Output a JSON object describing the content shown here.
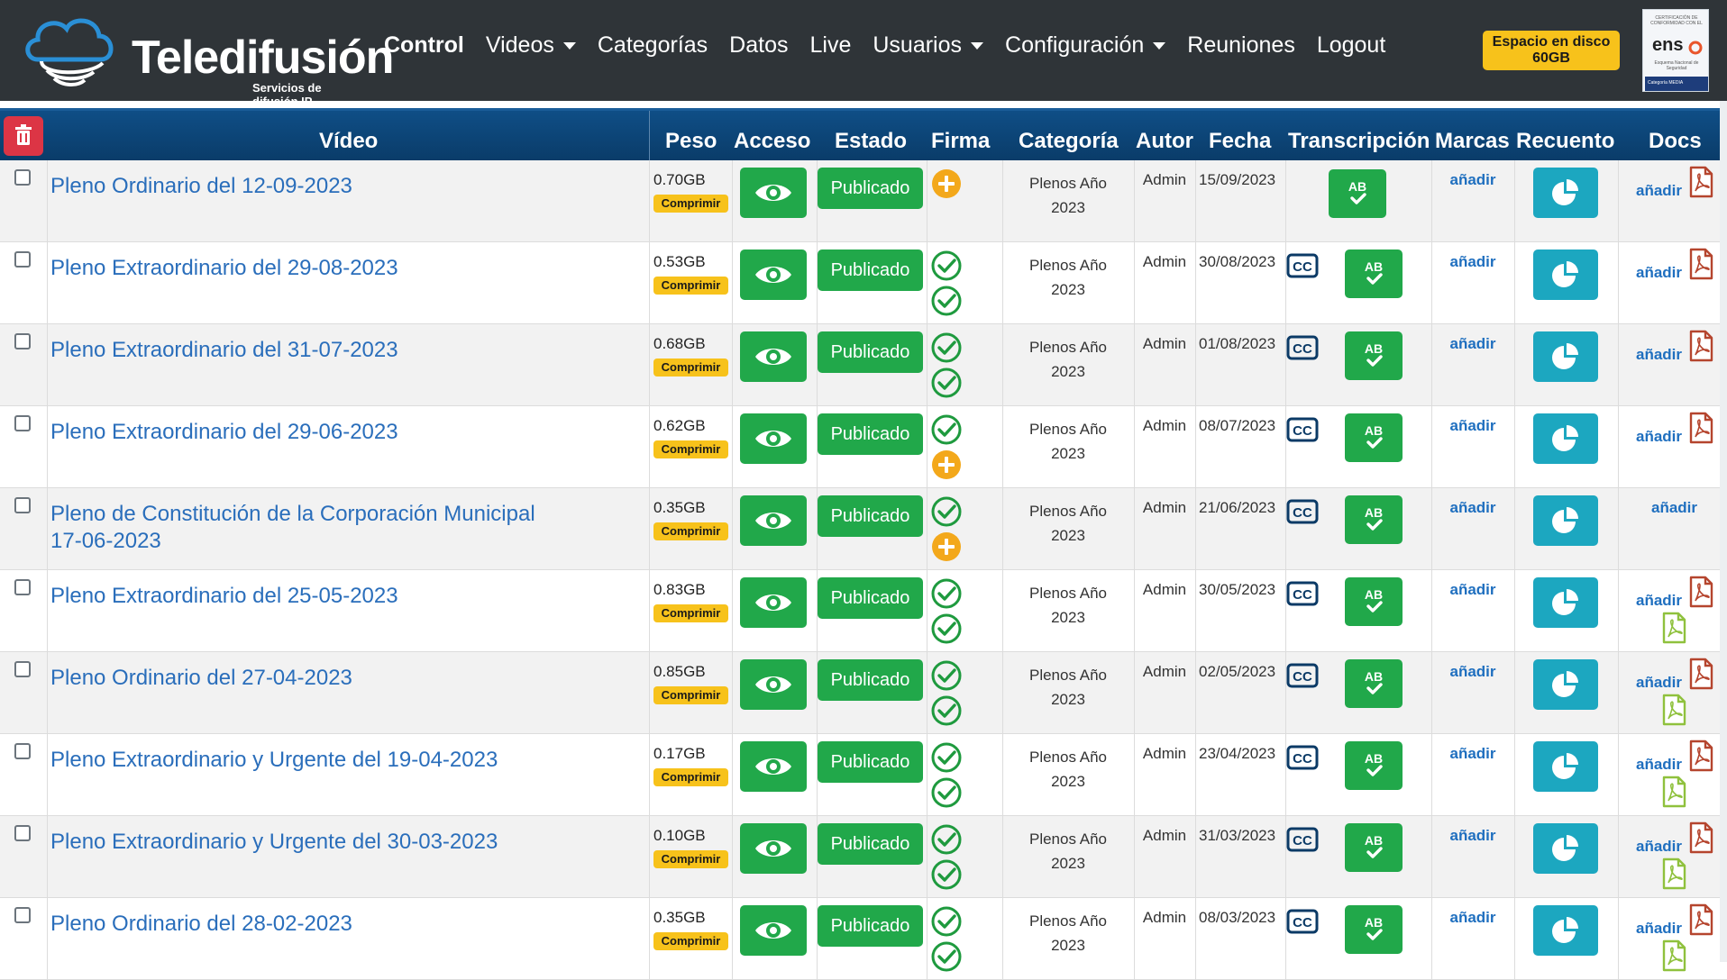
{
  "brand": {
    "name": "Teledifusión",
    "subtitle": "Servicios de difusión IP"
  },
  "nav": [
    {
      "label": "Control",
      "active": true,
      "dropdown": false
    },
    {
      "label": "Videos",
      "active": false,
      "dropdown": true
    },
    {
      "label": "Categorías",
      "active": false,
      "dropdown": false
    },
    {
      "label": "Datos",
      "active": false,
      "dropdown": false
    },
    {
      "label": "Live",
      "active": false,
      "dropdown": false
    },
    {
      "label": "Usuarios",
      "active": false,
      "dropdown": true
    },
    {
      "label": "Configuración",
      "active": false,
      "dropdown": true
    },
    {
      "label": "Reuniones",
      "active": false,
      "dropdown": false
    },
    {
      "label": "Logout",
      "active": false,
      "dropdown": false
    }
  ],
  "disk": {
    "line1": "Espacio en disco",
    "line2": "60GB"
  },
  "cert": {
    "top": "CERTIFICACIÓN DE CONFORMIDAD CON EL",
    "logo": "ens",
    "mid": "Esquema Nacional de Seguridad",
    "footer": "Categoría MEDIA"
  },
  "columns": {
    "video": "Vídeo",
    "peso": "Peso",
    "acceso": "Acceso",
    "estado": "Estado",
    "firma": "Firma",
    "categoria": "Categoría",
    "autor": "Autor",
    "fecha": "Fecha",
    "transcripcion": "Transcripción",
    "marcas": "Marcas",
    "recuento": "Recuento",
    "docs": "Docs"
  },
  "labels": {
    "comprimir": "Comprimir",
    "publicado": "Publicado",
    "anadir": "añadir",
    "ab": "AB",
    "cc": "CC"
  },
  "colors": {
    "navbar": "#2f3438",
    "header": "#0f4e86",
    "green": "#21a84a",
    "teal": "#1ca7c0",
    "yellow": "#f7c21b",
    "link": "#2a6ebb",
    "danger": "#dc3545"
  },
  "rows": [
    {
      "title": "Pleno Ordinario del 12-09-2023",
      "peso": "0.70GB",
      "firma": [
        "plus"
      ],
      "cat1": "Plenos Año",
      "cat2": "2023",
      "autor": "Admin",
      "fecha": "15/09/2023",
      "cc": false,
      "docs": [
        "red"
      ]
    },
    {
      "title": "Pleno Extraordinario del 29-08-2023",
      "peso": "0.53GB",
      "firma": [
        "check",
        "check"
      ],
      "cat1": "Plenos Año",
      "cat2": "2023",
      "autor": "Admin",
      "fecha": "30/08/2023",
      "cc": true,
      "docs": [
        "red"
      ]
    },
    {
      "title": "Pleno Extraordinario del 31-07-2023",
      "peso": "0.68GB",
      "firma": [
        "check",
        "check"
      ],
      "cat1": "Plenos Año",
      "cat2": "2023",
      "autor": "Admin",
      "fecha": "01/08/2023",
      "cc": true,
      "docs": [
        "red"
      ]
    },
    {
      "title": "Pleno Extraordinario del 29-06-2023",
      "peso": "0.62GB",
      "firma": [
        "check",
        "plus"
      ],
      "cat1": "Plenos Año",
      "cat2": "2023",
      "autor": "Admin",
      "fecha": "08/07/2023",
      "cc": true,
      "docs": [
        "red"
      ]
    },
    {
      "title": "Pleno de Constitución de la Corporación Municipal 17-06-2023",
      "peso": "0.35GB",
      "firma": [
        "check",
        "plus"
      ],
      "cat1": "Plenos Año",
      "cat2": "2023",
      "autor": "Admin",
      "fecha": "21/06/2023",
      "cc": true,
      "docs": []
    },
    {
      "title": "Pleno Extraordinario del 25-05-2023",
      "peso": "0.83GB",
      "firma": [
        "check",
        "check"
      ],
      "cat1": "Plenos Año",
      "cat2": "2023",
      "autor": "Admin",
      "fecha": "30/05/2023",
      "cc": true,
      "docs": [
        "red",
        "green"
      ]
    },
    {
      "title": "Pleno Ordinario del 27-04-2023",
      "peso": "0.85GB",
      "firma": [
        "check",
        "check"
      ],
      "cat1": "Plenos Año",
      "cat2": "2023",
      "autor": "Admin",
      "fecha": "02/05/2023",
      "cc": true,
      "docs": [
        "red",
        "green"
      ]
    },
    {
      "title": "Pleno Extraordinario y Urgente del 19-04-2023",
      "peso": "0.17GB",
      "firma": [
        "check",
        "check"
      ],
      "cat1": "Plenos Año",
      "cat2": "2023",
      "autor": "Admin",
      "fecha": "23/04/2023",
      "cc": true,
      "docs": [
        "red",
        "green"
      ]
    },
    {
      "title": "Pleno Extraordinario y Urgente del 30-03-2023",
      "peso": "0.10GB",
      "firma": [
        "check",
        "check"
      ],
      "cat1": "Plenos Año",
      "cat2": "2023",
      "autor": "Admin",
      "fecha": "31/03/2023",
      "cc": true,
      "docs": [
        "red",
        "green"
      ]
    },
    {
      "title": "Pleno Ordinario del 28-02-2023",
      "peso": "0.35GB",
      "firma": [
        "check",
        "check"
      ],
      "cat1": "Plenos Año",
      "cat2": "2023",
      "autor": "Admin",
      "fecha": "08/03/2023",
      "cc": true,
      "docs": [
        "red",
        "green"
      ]
    }
  ]
}
